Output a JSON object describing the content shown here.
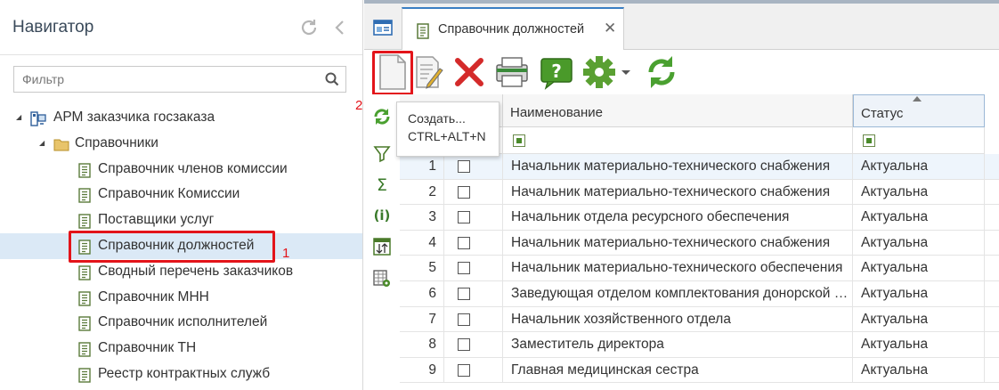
{
  "navigator": {
    "title": "Навигатор",
    "filter_placeholder": "Фильтр",
    "tree": [
      {
        "label": "АРМ заказчика госзаказа",
        "level": 0,
        "type": "root",
        "expanded": true
      },
      {
        "label": "Справочники",
        "level": 1,
        "type": "folder",
        "expanded": true
      },
      {
        "label": "Справочник членов комиссии",
        "level": 2,
        "type": "doc"
      },
      {
        "label": "Справочник Комиссии",
        "level": 2,
        "type": "doc"
      },
      {
        "label": "Поставщики услуг",
        "level": 2,
        "type": "doc"
      },
      {
        "label": "Справочник должностей",
        "level": 2,
        "type": "doc",
        "selected": true
      },
      {
        "label": "Сводный перечень заказчиков",
        "level": 2,
        "type": "doc"
      },
      {
        "label": "Справочник МНН",
        "level": 2,
        "type": "doc"
      },
      {
        "label": "Справочник исполнителей",
        "level": 2,
        "type": "doc"
      },
      {
        "label": "Справочник ТН",
        "level": 2,
        "type": "doc"
      },
      {
        "label": "Реестр контрактных служб",
        "level": 2,
        "type": "doc"
      }
    ]
  },
  "annotations": {
    "step1": "1",
    "step2": "2"
  },
  "tab": {
    "label": "Справочник должностей",
    "close": "✕"
  },
  "toolbar": {
    "buttons": [
      "create",
      "edit",
      "delete",
      "print",
      "help",
      "settings",
      "refresh"
    ]
  },
  "tooltip": {
    "title": "Создать...",
    "shortcut": "CTRL+ALT+N"
  },
  "grid": {
    "columns": {
      "name": "Наименование",
      "status": "Статус"
    },
    "rows": [
      {
        "num": "1",
        "name": "Начальник материально-технического снабжения",
        "status": "Актуальна"
      },
      {
        "num": "2",
        "name": "Начальник материально-технического снабжения",
        "status": "Актуальна"
      },
      {
        "num": "3",
        "name": "Начальник отдела ресурсного обеспечения",
        "status": "Актуальна"
      },
      {
        "num": "4",
        "name": "Начальник материально-технического снабжения",
        "status": "Актуальна"
      },
      {
        "num": "5",
        "name": "Начальник материально-технического обеспечения",
        "status": "Актуальна"
      },
      {
        "num": "6",
        "name": "Заведующая отделом комплектования донорской крови",
        "status": "Актуальна"
      },
      {
        "num": "7",
        "name": "Начальник хозяйственного отдела",
        "status": "Актуальна"
      },
      {
        "num": "8",
        "name": "Заместитель директора",
        "status": "Актуальна"
      },
      {
        "num": "9",
        "name": "Главная медицинская сестра",
        "status": "Актуальна"
      }
    ]
  },
  "colors": {
    "accent": "#3a7ec3",
    "highlight": "#e3141a",
    "selected_row": "#dbe9f6"
  }
}
